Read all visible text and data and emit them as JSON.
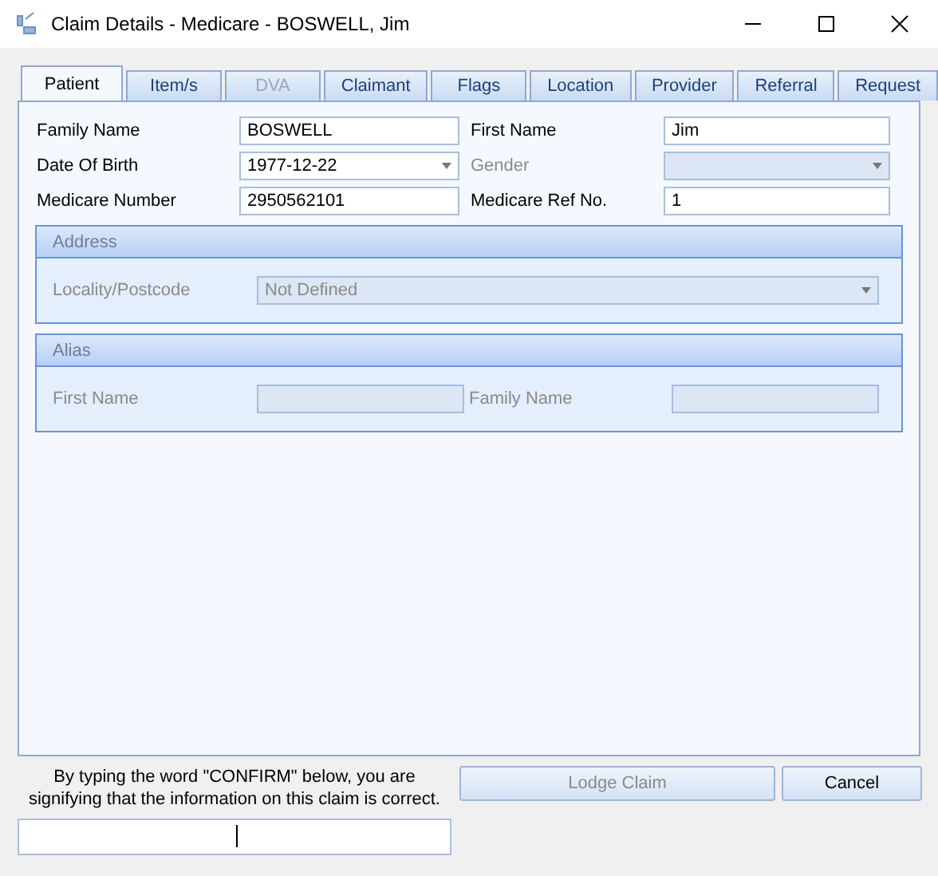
{
  "window": {
    "title": "Claim Details - Medicare - BOSWELL, Jim"
  },
  "tabs": [
    {
      "label": "Patient",
      "selected": true,
      "disabled": false
    },
    {
      "label": "Item/s",
      "selected": false,
      "disabled": false
    },
    {
      "label": "DVA",
      "selected": false,
      "disabled": true
    },
    {
      "label": "Claimant",
      "selected": false,
      "disabled": false
    },
    {
      "label": "Flags",
      "selected": false,
      "disabled": false
    },
    {
      "label": "Location",
      "selected": false,
      "disabled": false
    },
    {
      "label": "Provider",
      "selected": false,
      "disabled": false
    },
    {
      "label": "Referral",
      "selected": false,
      "disabled": false
    },
    {
      "label": "Request",
      "selected": false,
      "disabled": false
    }
  ],
  "patient_fields": [
    {
      "label": "Family Name",
      "value": "BOSWELL",
      "kind": "text",
      "disabled": false
    },
    {
      "label": "First Name",
      "value": "Jim",
      "kind": "text",
      "disabled": false
    },
    {
      "label": "Date Of Birth",
      "value": "1977-12-22",
      "kind": "dropdown",
      "disabled": false
    },
    {
      "label": "Gender",
      "kind": "dropdown",
      "disabled": true
    },
    {
      "label": "Medicare Number",
      "value": "2950562101",
      "kind": "text",
      "disabled": false
    },
    {
      "label": "Medicare Ref No.",
      "value": "1",
      "kind": "text",
      "disabled": false
    }
  ],
  "groups": [
    {
      "title": "Address",
      "fields": [
        {
          "label": "Locality/Postcode",
          "value": "Not Defined",
          "kind": "dropdown",
          "disabled": true
        }
      ]
    },
    {
      "title": "Alias",
      "fields": [
        {
          "label": "First Name",
          "kind": "text",
          "disabled": true
        },
        {
          "label": "Family Name",
          "kind": "text",
          "disabled": true
        }
      ]
    }
  ],
  "confirm": {
    "text": "By typing the word \"CONFIRM\" below, you are signifying that the information on this claim is correct."
  },
  "buttons": [
    {
      "label": "Lodge Claim",
      "disabled": true
    },
    {
      "label": "Cancel",
      "disabled": false
    }
  ]
}
